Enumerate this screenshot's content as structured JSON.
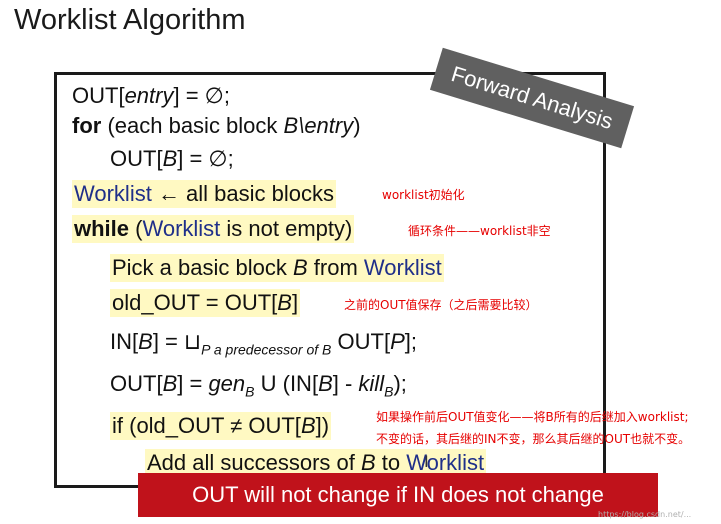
{
  "title": "Worklist Algorithm",
  "banner_forward": "Forward Analysis",
  "banner_bottom": "OUT will not change if IN does not change",
  "lines": {
    "l1": {
      "a": "OUT[",
      "b": "entry",
      "c": "] = ∅;"
    },
    "l2": {
      "kw": "for",
      "a": " (each basic block ",
      "b": "B\\entry",
      "c": ")"
    },
    "l3": {
      "a": "OUT[",
      "b": "B",
      "c": "] = ∅;"
    },
    "l4": {
      "a": "Worklist",
      "b": " ← all basic blocks"
    },
    "l5": {
      "kw": "while",
      "a": " (",
      "b": "Worklist",
      "c": " is not empty)"
    },
    "l6": {
      "a": "Pick a basic block ",
      "b": "B",
      "c": " from ",
      "d": "Worklist"
    },
    "l7": {
      "a": "old_OUT = OUT[",
      "b": "B",
      "c": "]"
    },
    "l8": {
      "a": "IN[",
      "b": "B",
      "c": "] = ⊔",
      "d": "P a predecessor of B",
      "e": " OUT[",
      "f": "P",
      "g": "];"
    },
    "l9": {
      "a": "OUT[",
      "b": "B",
      "c": "] = ",
      "d": "gen",
      "e": "B",
      "f": " U (IN[",
      "g": "B",
      "h": "] - ",
      "i": "kill",
      "j": "B",
      "k": ");"
    },
    "l10": {
      "a": "if (old_OUT ≠ OUT[",
      "b": "B",
      "c": "])"
    },
    "l11": {
      "a": "Add all successors of ",
      "b": "B",
      "c": " to ",
      "d": "Worklist"
    }
  },
  "notes": {
    "n1": "worklist初始化",
    "n2": "循环条件——worklist非空",
    "n3": "之前的OUT值保存（之后需要比较）",
    "n4": "如果操作前后OUT值变化——将B所有的后继加入worklist;",
    "n5": "不变的话，其后继的IN不变，那么其后继的OUT也就不变。"
  },
  "watermark": "https://blog.csdn.net/..."
}
